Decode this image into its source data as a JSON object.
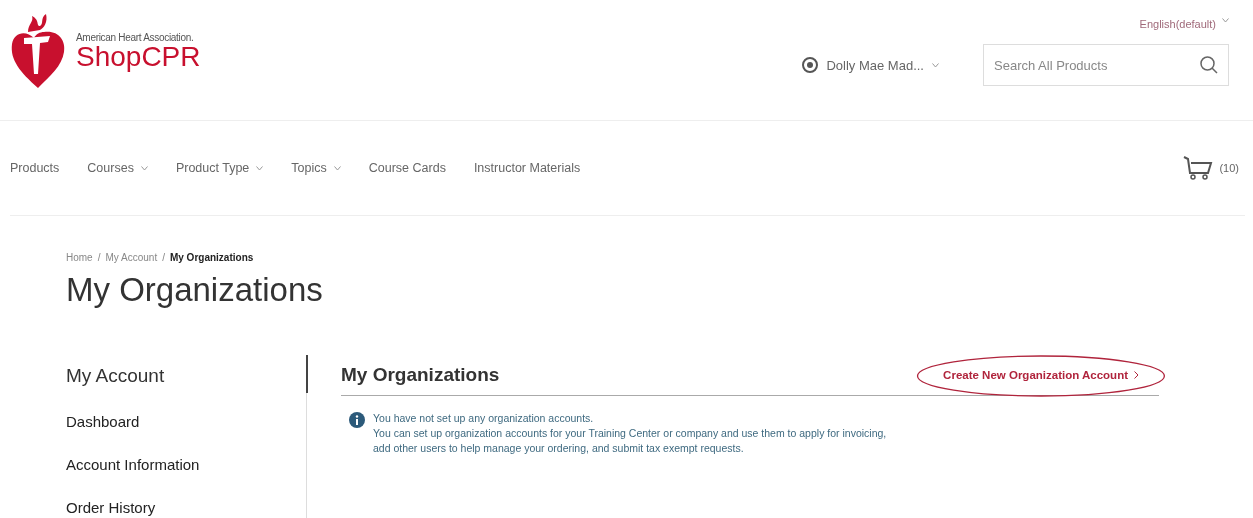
{
  "header": {
    "brand_small": "American Heart Association.",
    "brand": "ShopCPR",
    "language": "English(default)",
    "user": "Dolly Mae Mad...",
    "search": {
      "placeholder": "Search All Products"
    }
  },
  "nav": [
    {
      "label": "Products",
      "caret": false
    },
    {
      "label": "Courses",
      "caret": true
    },
    {
      "label": "Product Type",
      "caret": true
    },
    {
      "label": "Topics",
      "caret": true
    },
    {
      "label": "Course Cards",
      "caret": false
    },
    {
      "label": "Instructor Materials",
      "caret": false
    }
  ],
  "cart": {
    "count": "(10)"
  },
  "breadcrumb": [
    {
      "label": "Home",
      "current": false
    },
    {
      "label": "My Account",
      "current": false
    },
    {
      "label": "My Organizations",
      "current": true
    }
  ],
  "breadcrumb_separator": "/",
  "page_title": "My Organizations",
  "sidebar": {
    "title": "My Account",
    "items": [
      "Dashboard",
      "Account Information",
      "Order History"
    ]
  },
  "main": {
    "heading": "My Organizations",
    "action": {
      "label": "Create New Organization Account",
      "highlighted": true
    },
    "info": [
      "You have not set up any organization accounts.",
      "You can set up organization accounts for your Training Center or company and use them to apply for invoicing,",
      "add other users to help manage your ordering, and submit tax exempt requests."
    ]
  }
}
